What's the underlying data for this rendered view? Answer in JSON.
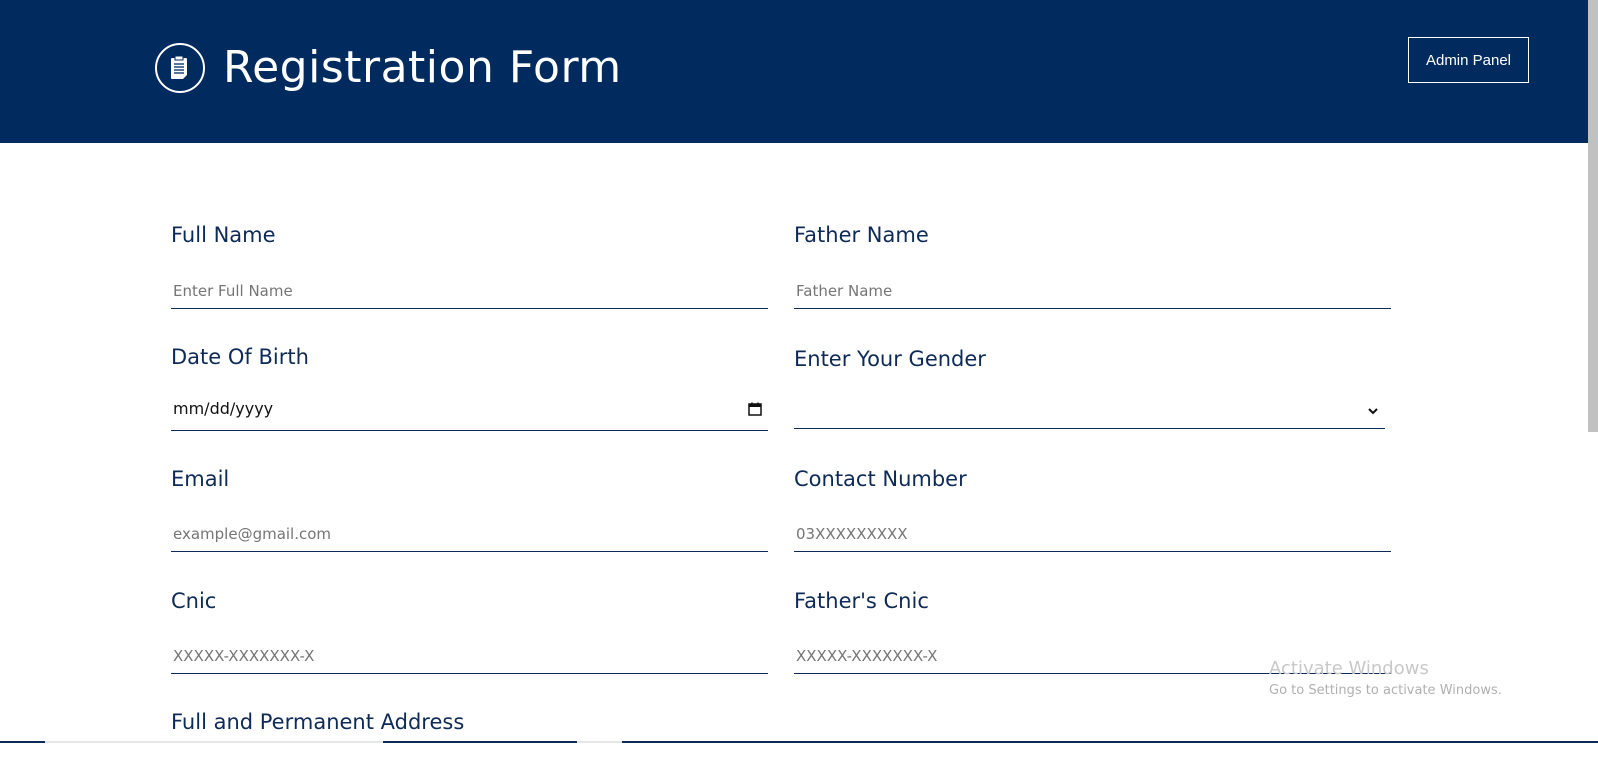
{
  "header": {
    "title": "Registration Form",
    "admin_button": "Admin Panel",
    "background": "#012a5e",
    "logo_icon": "clipboard-icon"
  },
  "form": {
    "full_name": {
      "label": "Full Name",
      "placeholder": "Enter Full Name"
    },
    "father_name": {
      "label": "Father Name",
      "placeholder": "Father Name"
    },
    "dob": {
      "label": "Date Of Birth",
      "value": "mm/dd/yyyy"
    },
    "gender": {
      "label": "Enter Your Gender",
      "value": ""
    },
    "email": {
      "label": "Email",
      "placeholder": "example@gmail.com"
    },
    "contact": {
      "label": "Contact Number",
      "placeholder": "03XXXXXXXXX"
    },
    "cnic": {
      "label": "Cnic",
      "placeholder": "XXXXX-XXXXXXX-X"
    },
    "father_cnic": {
      "label": "Father's Cnic",
      "placeholder": "XXXXX-XXXXXXX-X"
    },
    "address": {
      "label": "Full and Permanent Address"
    }
  },
  "watermark": {
    "line1": "Activate Windows",
    "line2": "Go to Settings to activate Windows."
  },
  "colors": {
    "accent": "#0e2a57"
  }
}
